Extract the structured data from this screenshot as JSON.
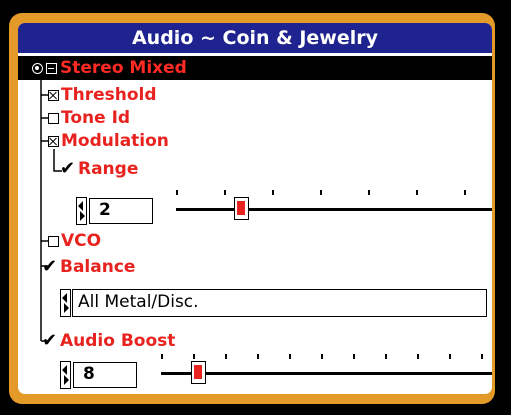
{
  "title": "Audio ~ Coin & Jewelry",
  "root": {
    "label": "Stereo Mixed"
  },
  "items": {
    "threshold": {
      "label": "Threshold",
      "checked": true
    },
    "tone_id": {
      "label": "Tone Id",
      "checked": false
    },
    "modulation": {
      "label": "Modulation",
      "checked": true
    },
    "range": {
      "label": "Range",
      "value": "2",
      "slider_fraction": 0.23
    },
    "vco": {
      "label": "VCO",
      "checked": false
    },
    "balance": {
      "label": "Balance",
      "option": "All Metal/Disc."
    },
    "audio_boost": {
      "label": "Audio Boost",
      "value": "8",
      "slider_fraction": 0.1
    }
  },
  "colors": {
    "frame": "#e39a28",
    "title_bg": "#1f238f",
    "label": "#e8231f",
    "knob": "#e8231f"
  }
}
